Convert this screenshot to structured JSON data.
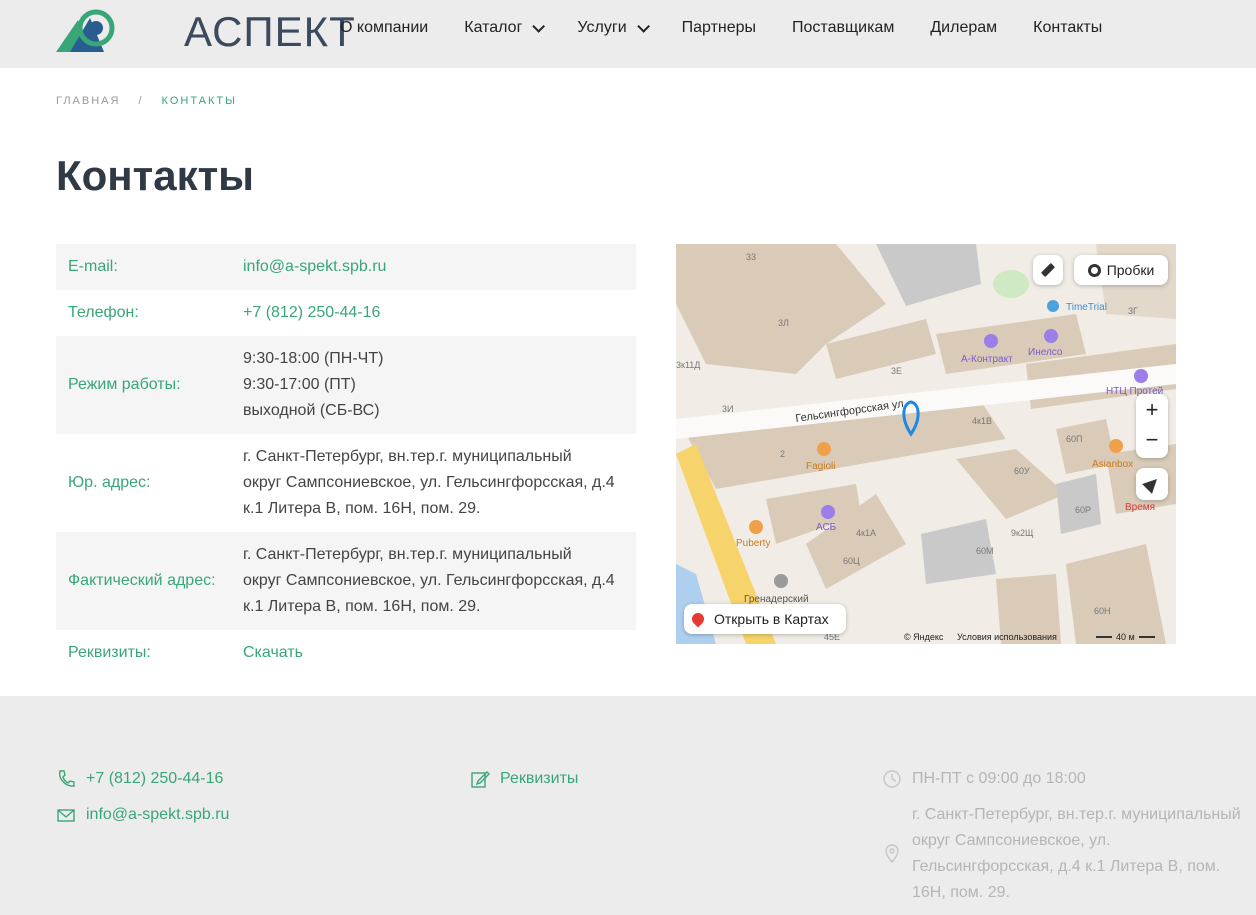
{
  "header": {
    "logo_text": "АСПЕКТ",
    "nav": [
      {
        "label": "О компании",
        "dropdown": false
      },
      {
        "label": "Каталог",
        "dropdown": true
      },
      {
        "label": "Услуги",
        "dropdown": true
      },
      {
        "label": "Партнеры",
        "dropdown": false
      },
      {
        "label": "Поставщикам",
        "dropdown": false
      },
      {
        "label": "Дилерам",
        "dropdown": false
      },
      {
        "label": "Контакты",
        "dropdown": false
      }
    ]
  },
  "breadcrumb": {
    "home": "ГЛАВНАЯ",
    "separator": "/",
    "current": "КОНТАКТЫ"
  },
  "page_title": "Контакты",
  "contacts": {
    "email": {
      "label": "E-mail:",
      "value": "info@a-spekt.spb.ru"
    },
    "phone": {
      "label": "Телефон:",
      "value": "+7 (812) 250-44-16"
    },
    "hours": {
      "label": "Режим работы:",
      "lines": [
        "9:30-18:00 (ПН-ЧТ)",
        "9:30-17:00 (ПТ)",
        "выходной (СБ-ВС)"
      ]
    },
    "legal": {
      "label": "Юр. адрес:",
      "lines": [
        "г. Санкт-Петербург, вн.тер.г. муниципальный",
        "округ Сампсониевское, ул. Гельсингфорсская, д.4",
        "к.1 Литера В, пом. 16Н, пом. 29."
      ]
    },
    "actual": {
      "label": "Фактический адрес:",
      "lines": [
        "г. Санкт-Петербург, вн.тер.г. муниципальный",
        "округ Сампсониевское, ул. Гельсингфорсская, д.4",
        "к.1 Литера В, пом. 16Н, пом. 29."
      ]
    },
    "requisites": {
      "label": "Реквизиты:",
      "value": "Скачать"
    }
  },
  "map": {
    "street": "Гельсингфорсская ул.",
    "traffic_button": "Пробки",
    "open_button": "Открыть в Картах",
    "copyright": "© Яндекс",
    "terms": "Условия использования",
    "scale": "40 м",
    "zoom_in": "+",
    "zoom_out": "−",
    "places": [
      "TimeTrial",
      "А-Контракт",
      "Инелсо",
      "НТЦ Протей",
      "Fagioli",
      "Asianbox",
      "Время",
      "АСБ",
      "Puberty",
      "Гренадерский"
    ],
    "house_numbers": [
      "33",
      "3Л",
      "3к11Д",
      "3Е",
      "3И",
      "3Г",
      "4к1В",
      "2",
      "60П",
      "60У",
      "60Р",
      "4к1А",
      "60Ц",
      "9к2Щ",
      "60М",
      "60Н",
      "45Е"
    ]
  },
  "footer": {
    "phone": "+7 (812) 250-44-16",
    "email": "info@a-spekt.spb.ru",
    "requisites": "Реквизиты",
    "hours": "ПН-ПТ с 09:00 до 18:00",
    "address_lines": [
      "г. Санкт-Петербург, вн.тер.г. муниципальный",
      "округ Сампсониевское, ул.",
      "Гельсингфорсская, д.4 к.1 Литера В, пом.",
      "16Н, пом. 29."
    ]
  },
  "colors": {
    "accent": "#39a677",
    "header_bg": "#ececec",
    "title": "#2f3a45"
  }
}
